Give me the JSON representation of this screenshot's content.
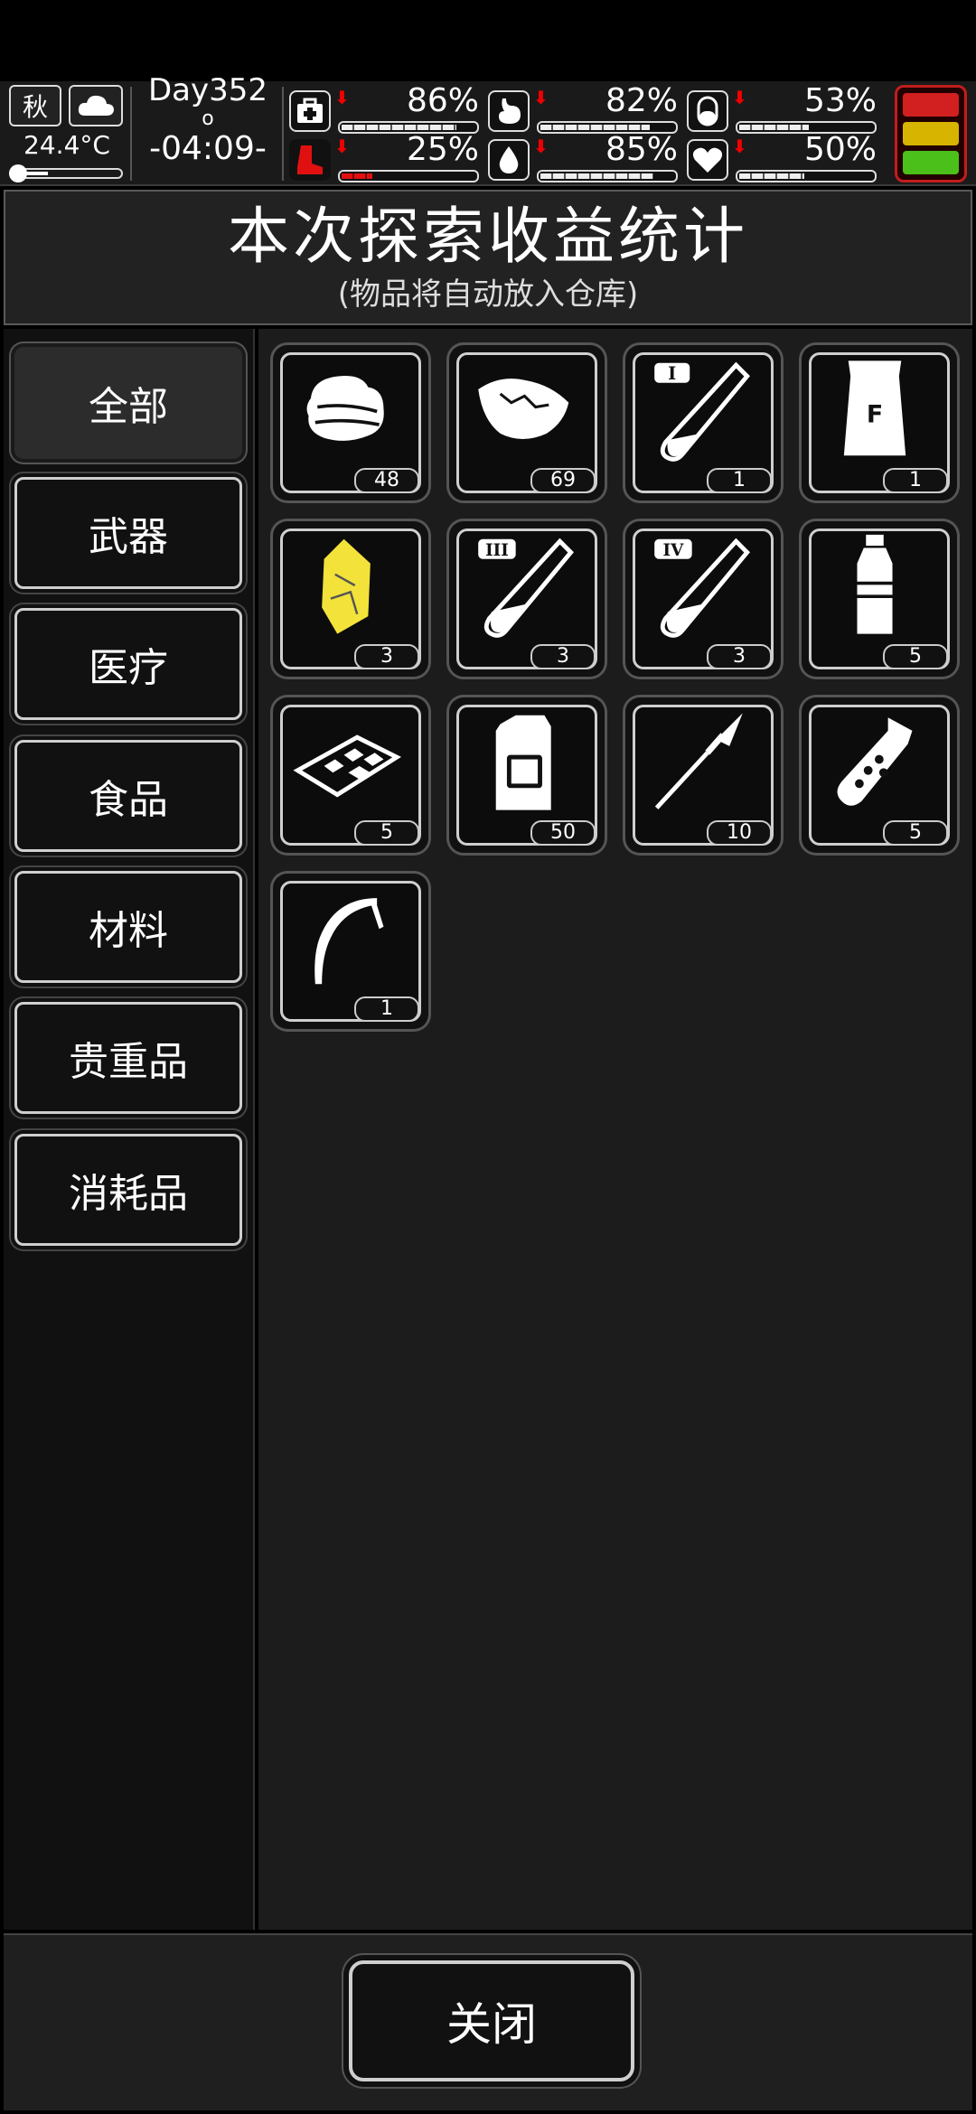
{
  "status": {
    "season": "秋",
    "weather_icon": "cloud-icon",
    "temperature": "24.4°C",
    "temperature_level": 0.3,
    "day": "Day352",
    "sun_marker": "o",
    "clock": "-04:09-",
    "stats": [
      {
        "name": "health",
        "icon": "medkit-icon",
        "value": "86%",
        "level": 0.86,
        "trend": "down"
      },
      {
        "name": "hunger",
        "icon": "stomach-icon",
        "value": "82%",
        "level": 0.82,
        "trend": "down"
      },
      {
        "name": "energy",
        "icon": "pill-icon",
        "value": "53%",
        "level": 0.53,
        "trend": "down"
      },
      {
        "name": "stamina",
        "icon": "boot-icon",
        "value": "25%",
        "level": 0.25,
        "trend": "down"
      },
      {
        "name": "thirst",
        "icon": "water-drop-icon",
        "value": "85%",
        "level": 0.85,
        "trend": "down"
      },
      {
        "name": "mood",
        "icon": "heart-icon",
        "value": "50%",
        "level": 0.5,
        "trend": "down"
      }
    ],
    "battery_colors": [
      "#d21f1f",
      "#d6b400",
      "#4bbf1a"
    ]
  },
  "header": {
    "title": "本次探索收益统计",
    "subtitle": "(物品将自动放入仓库)"
  },
  "categories": [
    {
      "label": "全部",
      "active": true
    },
    {
      "label": "武器",
      "active": false
    },
    {
      "label": "医疗",
      "active": false
    },
    {
      "label": "食品",
      "active": false
    },
    {
      "label": "材料",
      "active": false
    },
    {
      "label": "贵重品",
      "active": false
    },
    {
      "label": "消耗品",
      "active": false
    }
  ],
  "items": [
    {
      "icon": "cloth-icon",
      "count": "48"
    },
    {
      "icon": "leather-scrap-icon",
      "count": "69"
    },
    {
      "icon": "test-tube-i-icon",
      "count": "1"
    },
    {
      "icon": "fertilizer-bag-icon",
      "count": "1"
    },
    {
      "icon": "gold-ore-icon",
      "count": "3"
    },
    {
      "icon": "test-tube-iii-icon",
      "count": "3"
    },
    {
      "icon": "test-tube-iv-icon",
      "count": "3"
    },
    {
      "icon": "water-bottle-icon",
      "count": "5"
    },
    {
      "icon": "scrap-tray-icon",
      "count": "5"
    },
    {
      "icon": "fuel-canister-icon",
      "count": "50"
    },
    {
      "icon": "spear-icon",
      "count": "10"
    },
    {
      "icon": "grenade-icon",
      "count": "5"
    },
    {
      "icon": "sickle-icon",
      "count": "1"
    }
  ],
  "footer": {
    "close_label": "关闭"
  }
}
